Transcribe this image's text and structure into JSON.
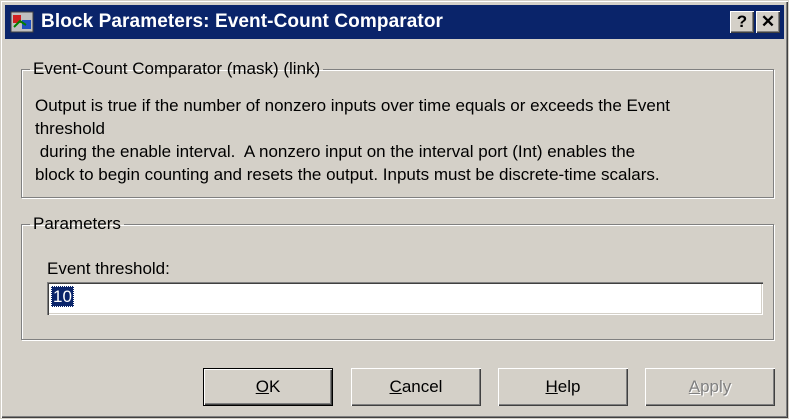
{
  "window": {
    "title": "Block Parameters: Event-Count Comparator",
    "help_button": "?",
    "close_button": "✕"
  },
  "description_group": {
    "legend": "Event-Count Comparator (mask) (link)",
    "lines": [
      "Output is true if the number of nonzero inputs over time equals or exceeds the Event",
      "threshold",
      " during the enable interval.  A nonzero input on the interval port (Int) enables the",
      "block to begin counting and resets the output.  Inputs must be discrete-time scalars."
    ]
  },
  "parameters_group": {
    "legend": "Parameters",
    "event_threshold_label": "Event threshold:",
    "event_threshold_value": "10"
  },
  "buttons": {
    "ok": {
      "mnemonic": "O",
      "rest": "K"
    },
    "cancel": {
      "mnemonic": "C",
      "rest": "ancel"
    },
    "help": {
      "mnemonic": "H",
      "rest": "elp"
    },
    "apply": {
      "mnemonic": "A",
      "rest": "pply",
      "enabled": false
    }
  },
  "colors": {
    "titlebar": "#0a246a",
    "face": "#d4d0c8"
  }
}
